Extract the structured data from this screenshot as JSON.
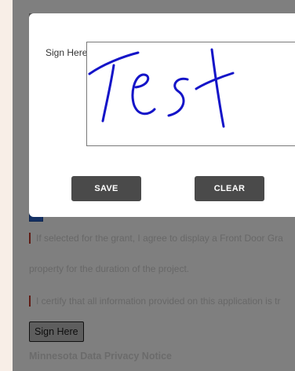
{
  "background_page": {
    "paragraph1_line1": "If selected for the grant, I agree to display a Front Door Gra",
    "paragraph1_line2": "property for the duration of the project.",
    "paragraph2": "I certify that all information provided on this application is tr",
    "sign_button_label": "Sign Here",
    "section_title": "Minnesota Data Privacy Notice"
  },
  "modal": {
    "sign_label": "Sign Here",
    "signature_text": "Test",
    "save_label": "SAVE",
    "clear_label": "CLEAR"
  },
  "colors": {
    "ink": "#1414c8",
    "required_marker": "#c0392b",
    "button_bg": "#4a4a4a",
    "checkbox": "#2b63c9"
  }
}
